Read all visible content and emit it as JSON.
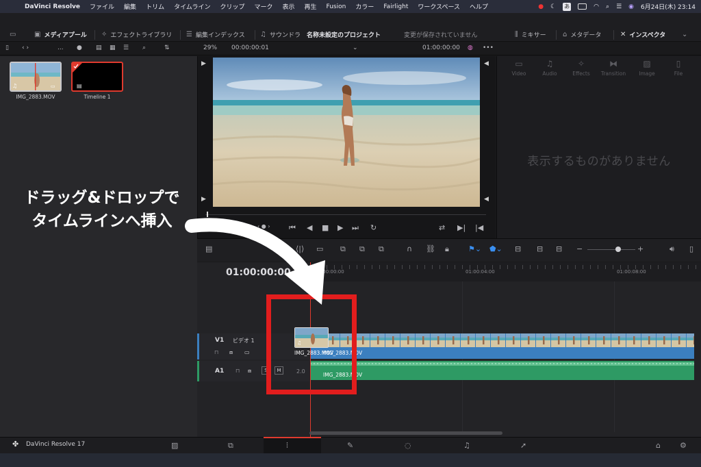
{
  "menubar": {
    "app": "DaVinci Resolve",
    "items": [
      "ファイル",
      "編集",
      "トリム",
      "タイムライン",
      "クリップ",
      "マーク",
      "表示",
      "再生",
      "Fusion",
      "カラー",
      "Fairlight",
      "ワークスペース",
      "ヘルプ"
    ],
    "datetime": "6月24日(木) 23:14",
    "ime": "あ"
  },
  "toolbar": {
    "media_pool": "メディアプール",
    "effects_library": "エフェクトライブラリ",
    "edit_index": "編集インデックス",
    "sound_library": "サウンドラ",
    "project_title": "名称未設定のプロジェクト",
    "save_status": "変更が保存されていません",
    "mixer": "ミキサー",
    "metadata": "メタデータ",
    "inspector": "インスペクタ"
  },
  "subbar": {
    "dots": "...",
    "zoom": "29%",
    "source_tc": "00:00:00:01",
    "record_tc": "01:00:00:00"
  },
  "media_pool": {
    "clips": [
      {
        "name": "IMG_2883.MOV"
      },
      {
        "name": "Timeline 1"
      }
    ]
  },
  "inspector": {
    "tabs": [
      "Video",
      "Audio",
      "Effects",
      "Transition",
      "Image",
      "File"
    ],
    "empty_message": "表示するものがありません"
  },
  "timeline": {
    "timecode": "01:00:00:00",
    "ruler": [
      "01:00:00:00",
      "01:00:04:00",
      "01:00:08:00"
    ],
    "video_track": {
      "id": "V1",
      "name": "ビデオ 1"
    },
    "audio_track": {
      "id": "A1",
      "level": "2.0",
      "solo": "S",
      "mute": "M"
    },
    "video_clip": "IMG_2883.MOV",
    "audio_clip": "IMG_2883.MOV",
    "drag_clip": "IMG_2883.MOV"
  },
  "annotation": {
    "line1": "ドラッグ&ドロップで",
    "line2": "タイムラインへ挿入"
  },
  "bottom": {
    "product": "DaVinci Resolve 17"
  },
  "colors": {
    "playhead": "#e03a2e",
    "video_clip": "#3b7fbf",
    "audio_clip": "#2e9a64",
    "annotation_box": "#e21d1d"
  }
}
